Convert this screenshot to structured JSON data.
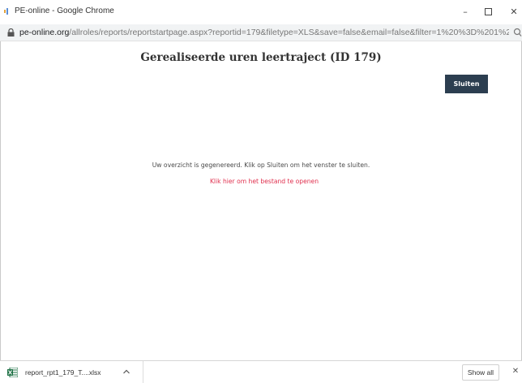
{
  "window": {
    "title": "PE-online - Google Chrome",
    "minimize_glyph": "–",
    "close_glyph": "✕"
  },
  "address_bar": {
    "host": "pe-online.org",
    "path": "/allroles/reports/reportstartpage.aspx?reportid=179&filetype=XLS&save=false&email=false&filter=1%20%3D%201%20...",
    "icons": [
      "lock-icon",
      "zoom-icon"
    ]
  },
  "page": {
    "title": "Gerealiseerde uren leertraject (ID 179)",
    "close_button_label": "Sluiten",
    "status_message": "Uw overzicht is gegenereerd. Klik op Sluiten om het venster te sluiten.",
    "open_link_text": "Klik hier om het bestand te openen"
  },
  "download_bar": {
    "filename": "report_rpt1_179_T....xlsx",
    "show_all_label": "Show all",
    "close_glyph": "✕"
  },
  "colors": {
    "button_bg": "#2c3e50",
    "link": "#e0304e",
    "excel_green": "#1e7145"
  }
}
